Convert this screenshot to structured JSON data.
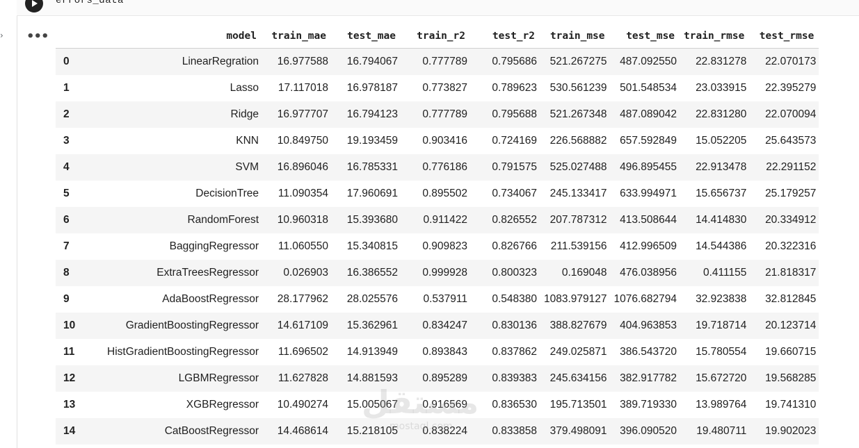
{
  "cell": {
    "code": "errors_data"
  },
  "output": {
    "menu_label": "•••"
  },
  "table": {
    "columns": [
      "model",
      "train_mae",
      "test_mae",
      "train_r2",
      "test_r2",
      "train_mse",
      "test_mse",
      "train_rmse",
      "test_rmse"
    ],
    "rows": [
      {
        "index": "0",
        "cells": [
          "LinearRegration",
          "16.977588",
          "16.794067",
          "0.777789",
          "0.795686",
          "521.267275",
          "487.092550",
          "22.831278",
          "22.070173"
        ]
      },
      {
        "index": "1",
        "cells": [
          "Lasso",
          "17.117018",
          "16.978187",
          "0.773827",
          "0.789623",
          "530.561239",
          "501.548534",
          "23.033915",
          "22.395279"
        ]
      },
      {
        "index": "2",
        "cells": [
          "Ridge",
          "16.977707",
          "16.794123",
          "0.777789",
          "0.795688",
          "521.267348",
          "487.089042",
          "22.831280",
          "22.070094"
        ]
      },
      {
        "index": "3",
        "cells": [
          "KNN",
          "10.849750",
          "19.193459",
          "0.903416",
          "0.724169",
          "226.568882",
          "657.592849",
          "15.052205",
          "25.643573"
        ]
      },
      {
        "index": "4",
        "cells": [
          "SVM",
          "16.896046",
          "16.785331",
          "0.776186",
          "0.791575",
          "525.027488",
          "496.895455",
          "22.913478",
          "22.291152"
        ]
      },
      {
        "index": "5",
        "cells": [
          "DecisionTree",
          "11.090354",
          "17.960691",
          "0.895502",
          "0.734067",
          "245.133417",
          "633.994971",
          "15.656737",
          "25.179257"
        ]
      },
      {
        "index": "6",
        "cells": [
          "RandomForest",
          "10.960318",
          "15.393680",
          "0.911422",
          "0.826552",
          "207.787312",
          "413.508644",
          "14.414830",
          "20.334912"
        ]
      },
      {
        "index": "7",
        "cells": [
          "BaggingRegressor",
          "11.060550",
          "15.340815",
          "0.909823",
          "0.826766",
          "211.539156",
          "412.996509",
          "14.544386",
          "20.322316"
        ]
      },
      {
        "index": "8",
        "cells": [
          "ExtraTreesRegressor",
          "0.026903",
          "16.386552",
          "0.999928",
          "0.800323",
          "0.169048",
          "476.038956",
          "0.411155",
          "21.818317"
        ]
      },
      {
        "index": "9",
        "cells": [
          "AdaBoostRegressor",
          "28.177962",
          "28.025576",
          "0.537911",
          "0.548380",
          "1083.979127",
          "1076.682794",
          "32.923838",
          "32.812845"
        ]
      },
      {
        "index": "10",
        "cells": [
          "GradientBoostingRegressor",
          "14.617109",
          "15.362961",
          "0.834247",
          "0.830136",
          "388.827679",
          "404.963853",
          "19.718714",
          "20.123714"
        ]
      },
      {
        "index": "11",
        "cells": [
          "HistGradientBoostingRegressor",
          "11.696502",
          "14.913949",
          "0.893843",
          "0.837862",
          "249.025871",
          "386.543720",
          "15.780554",
          "19.660715"
        ]
      },
      {
        "index": "12",
        "cells": [
          "LGBMRegressor",
          "11.627828",
          "14.881593",
          "0.895289",
          "0.839383",
          "245.634156",
          "382.917782",
          "15.672720",
          "19.568285"
        ]
      },
      {
        "index": "13",
        "cells": [
          "XGBRegressor",
          "10.490274",
          "15.005067",
          "0.916569",
          "0.836530",
          "195.713501",
          "389.719330",
          "13.989764",
          "19.741310"
        ]
      },
      {
        "index": "14",
        "cells": [
          "CatBoostRegressor",
          "14.468614",
          "15.218105",
          "0.838224",
          "0.833858",
          "379.498091",
          "396.090520",
          "19.480711",
          "19.902023"
        ]
      }
    ]
  },
  "watermark": {
    "text": "مستقل",
    "sub": "mostaql.com"
  }
}
